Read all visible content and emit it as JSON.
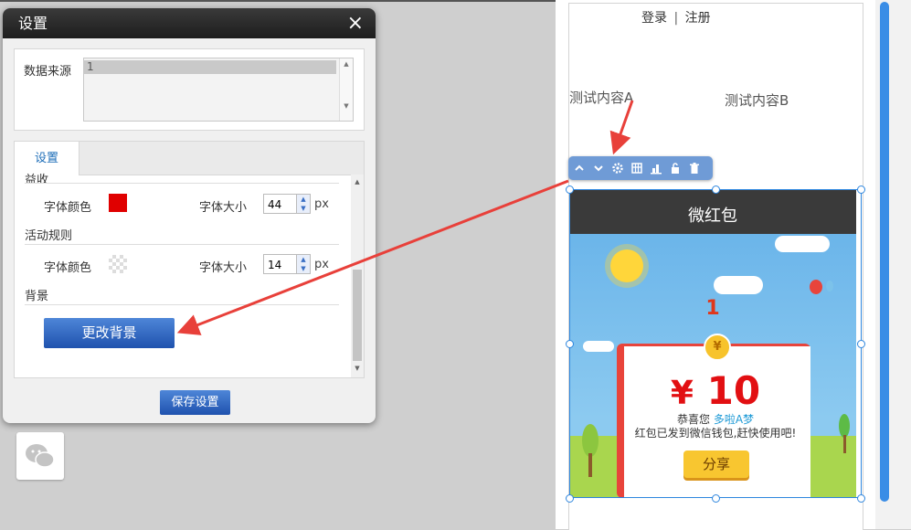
{
  "dialog": {
    "title": "设置",
    "close": "×",
    "data_source_label": "数据来源",
    "data_source_value": "1",
    "tab_settings": "设置",
    "section_partial": "益收",
    "row1": {
      "color_label": "字体颜色",
      "color": "#e00000",
      "size_label": "字体大小",
      "size": "44",
      "unit": "px"
    },
    "section_rules": "活动规则",
    "row2": {
      "color_label": "字体颜色",
      "color": "transparent",
      "size_label": "字体大小",
      "size": "14",
      "unit": "px"
    },
    "section_bg": "背景",
    "change_bg_button": "更改背景",
    "save_button": "保存设置"
  },
  "editor": {
    "login_link": "登录",
    "separator": "|",
    "register_link": "注册",
    "test_a": "测试内容A",
    "test_b": "测试内容B",
    "toolbar_icons": [
      "move-up-icon",
      "move-down-icon",
      "gear-icon",
      "columns-icon",
      "chart-icon",
      "unlock-icon",
      "trash-icon"
    ],
    "widget": {
      "title": "微红包",
      "number": "1",
      "coin": "¥",
      "currency": "¥",
      "amount": "10",
      "congrats_prefix": "恭喜您",
      "user_name": "多啦A梦",
      "sent_text": "红包已发到微信钱包,赶快使用吧!",
      "share_button": "分享"
    }
  },
  "sidebar": {
    "wechat_icon": "wechat-icon"
  },
  "colors": {
    "accent": "#2e86de",
    "arrow": "#e8403a",
    "envelope": "#e8443b",
    "amount": "#e20f12"
  }
}
